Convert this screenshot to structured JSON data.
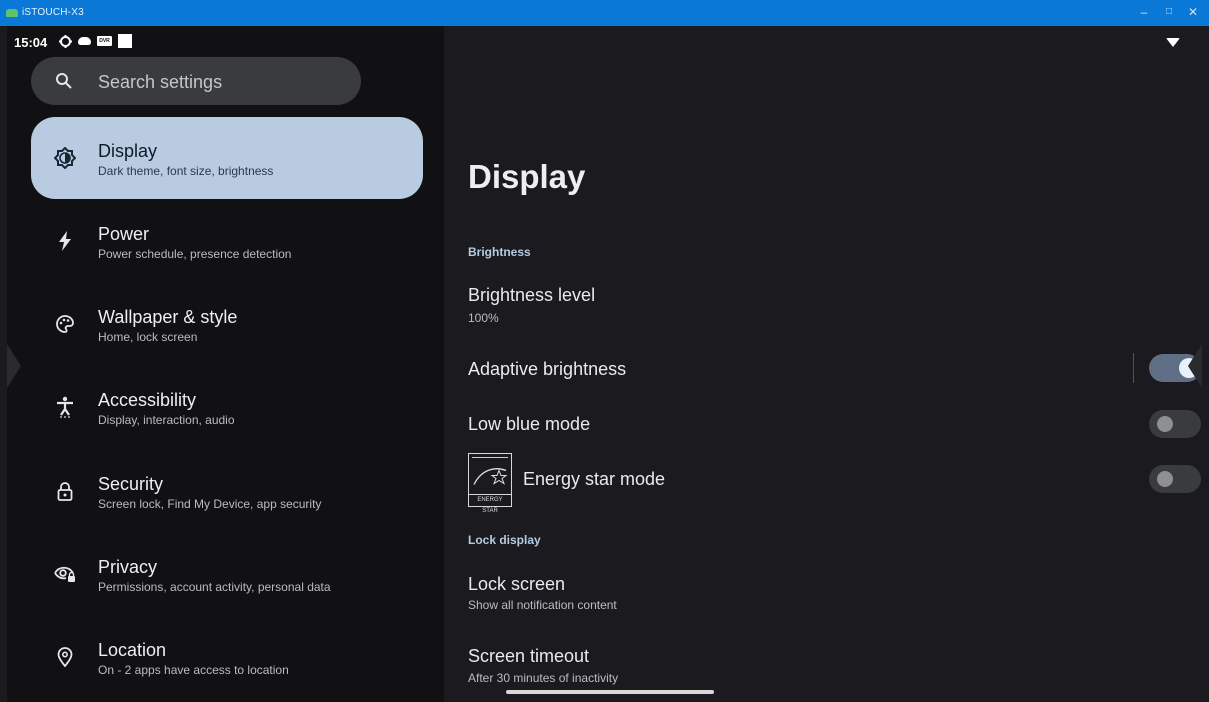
{
  "window": {
    "title": "iSTOUCH-X3",
    "controls": {
      "minimize": "–",
      "maximize": "□",
      "close": "✕"
    }
  },
  "status_bar": {
    "time": "15:04",
    "icons": [
      "settings-gear-icon",
      "cloud-icon",
      "dvr-icon",
      "square-notification-icon"
    ],
    "dvr_label": "DVR",
    "wifi_icon": "wifi-icon"
  },
  "search": {
    "placeholder": "Search settings"
  },
  "sidebar": {
    "items": [
      {
        "title": "Display",
        "subtitle": "Dark theme, font size, brightness",
        "icon": "brightness-icon",
        "active": true
      },
      {
        "title": "Power",
        "subtitle": "Power schedule, presence detection",
        "icon": "bolt-icon",
        "active": false
      },
      {
        "title": "Wallpaper & style",
        "subtitle": "Home, lock screen",
        "icon": "palette-icon",
        "active": false
      },
      {
        "title": "Accessibility",
        "subtitle": "Display, interaction, audio",
        "icon": "accessibility-icon",
        "active": false
      },
      {
        "title": "Security",
        "subtitle": "Screen lock, Find My Device, app security",
        "icon": "lock-icon",
        "active": false
      },
      {
        "title": "Privacy",
        "subtitle": "Permissions, account activity, personal data",
        "icon": "privacy-eye-icon",
        "active": false
      },
      {
        "title": "Location",
        "subtitle": "On - 2 apps have access to location",
        "icon": "location-pin-icon",
        "active": false
      }
    ]
  },
  "main": {
    "title": "Display",
    "sections": [
      {
        "header": "Brightness",
        "prefs": [
          {
            "title": "Brightness level",
            "subtitle": "100%"
          },
          {
            "title": "Adaptive brightness",
            "toggle": true
          },
          {
            "title": "Low blue mode",
            "toggle": false
          },
          {
            "title": "Energy star mode",
            "toggle": false,
            "logo_text": "ENERGY STAR"
          }
        ]
      },
      {
        "header": "Lock display",
        "prefs": [
          {
            "title": "Lock screen",
            "subtitle": "Show all notification content"
          },
          {
            "title": "Screen timeout",
            "subtitle": "After 30 minutes of inactivity"
          }
        ]
      }
    ]
  },
  "colors": {
    "titlebar": "#0a78d6",
    "active_item": "#b8cbe0",
    "toggle_on": "#5f7086",
    "toggle_off": "#3a3b3f",
    "section_header": "#b5cbe3"
  }
}
